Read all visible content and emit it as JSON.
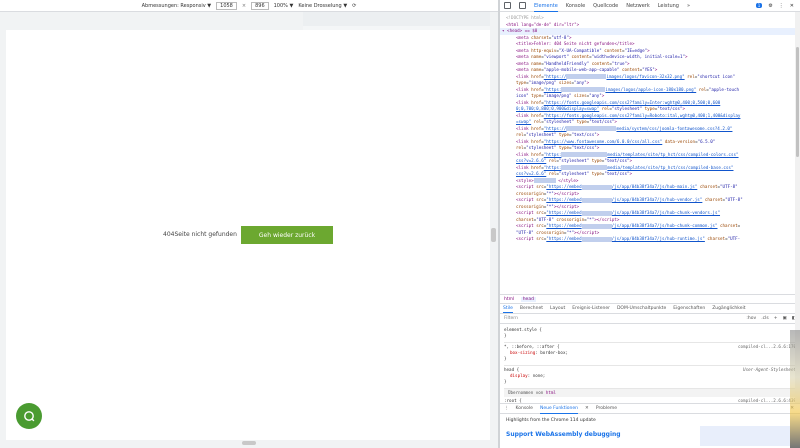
{
  "devbar": {
    "mode": "Abmessungen: Responsiv ▼",
    "width": "1058",
    "times": "×",
    "height": "896",
    "zoom": "100% ▼",
    "throttle": "Keine Drosselung ▼"
  },
  "page": {
    "notfound_text": "404Seite nicht gefunden",
    "back_button": "Geh wieder zurück"
  },
  "devtools": {
    "tabs": [
      "Elemente",
      "Konsole",
      "Quellcode",
      "Netzwerk",
      "Leistung"
    ],
    "more": "»",
    "badge": "1",
    "doctype": "<!DOCTYPE html>",
    "html_open": "<html lang=\"de-de\" dir=\"ltr\">",
    "head_open": "▾ <head> == $0",
    "title_line": "<title>Fehler: 404 Seite nicht gefunden</title>",
    "breadcrumbs": [
      "html",
      "head"
    ],
    "subtabs": [
      "Stile",
      "Berechnet",
      "Layout",
      "Ereignis-Listener",
      "DOM-Umschaltpunkte",
      "Eigenschaften",
      "Zugänglichkeit"
    ],
    "filter_placeholder": "Filtern",
    "filter_tools": [
      ":hov",
      ".cls",
      "+"
    ],
    "styles": {
      "element_style": "element.style {",
      "close": "}",
      "universal": "*, ::before, ::after {",
      "universal_prop": "box-sizing",
      "universal_val": "border-box;",
      "universal_src": "compiled-cl...2.6.6:170",
      "head_selector": "head {",
      "head_prop": "display",
      "head_val": "none;",
      "head_src": "User-Agent-Stylesheet",
      "inherited": "Übernommen von",
      "inherited_tag": "html",
      "root_selector": ":root {",
      "root_src": "compiled-cl...2.6.6:439"
    },
    "drawer": {
      "tabs": [
        "Konsole",
        "Neue Funktionen",
        "Probleme"
      ],
      "headline": "Highlights from the Chrome 114 update",
      "feature": "Support WebAssembly debugging"
    }
  }
}
